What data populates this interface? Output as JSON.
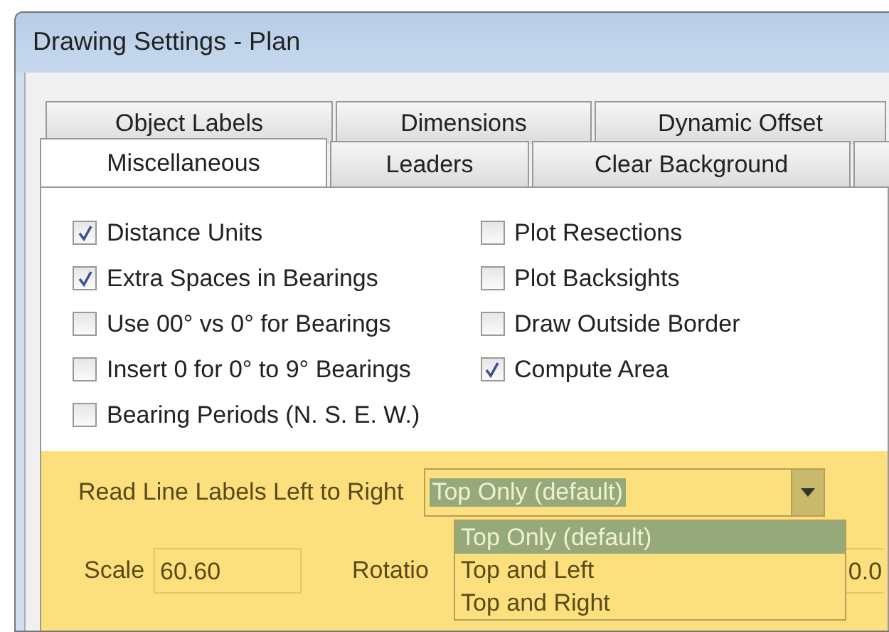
{
  "window": {
    "title": "Drawing Settings - Plan"
  },
  "tab_rows": [
    [
      {
        "label": "Object Labels",
        "selected": false
      },
      {
        "label": "Dimensions",
        "selected": false
      },
      {
        "label": "Dynamic Offset",
        "selected": false
      }
    ],
    [
      {
        "label": "Miscellaneous",
        "selected": true
      },
      {
        "label": "Leaders",
        "selected": false
      },
      {
        "label": "Clear Background",
        "selected": false
      }
    ]
  ],
  "left_options": [
    {
      "label": "Distance Units",
      "checked": true
    },
    {
      "label": "Extra Spaces in Bearings",
      "checked": true
    },
    {
      "label": "Use 00° vs 0° for Bearings",
      "checked": false
    },
    {
      "label": "Insert 0 for 0° to 9° Bearings",
      "checked": false
    },
    {
      "label": "Bearing Periods (N. S. E. W.)",
      "checked": false
    }
  ],
  "right_options": [
    {
      "label": "Plot Resections",
      "checked": false
    },
    {
      "label": "Plot Backsights",
      "checked": false
    },
    {
      "label": "Draw Outside Border",
      "checked": false
    },
    {
      "label": "Compute Area",
      "checked": true
    }
  ],
  "read_labels": {
    "label": "Read Line Labels Left to Right",
    "value": "Top Only (default)",
    "options": [
      {
        "label": "Top Only (default)",
        "selected": true
      },
      {
        "label": "Top and Left",
        "selected": false
      },
      {
        "label": "Top and Right",
        "selected": false
      }
    ]
  },
  "scale": {
    "label": "Scale",
    "value": "60.60"
  },
  "rotation": {
    "label": "Rotatio",
    "value": "0.0"
  }
}
